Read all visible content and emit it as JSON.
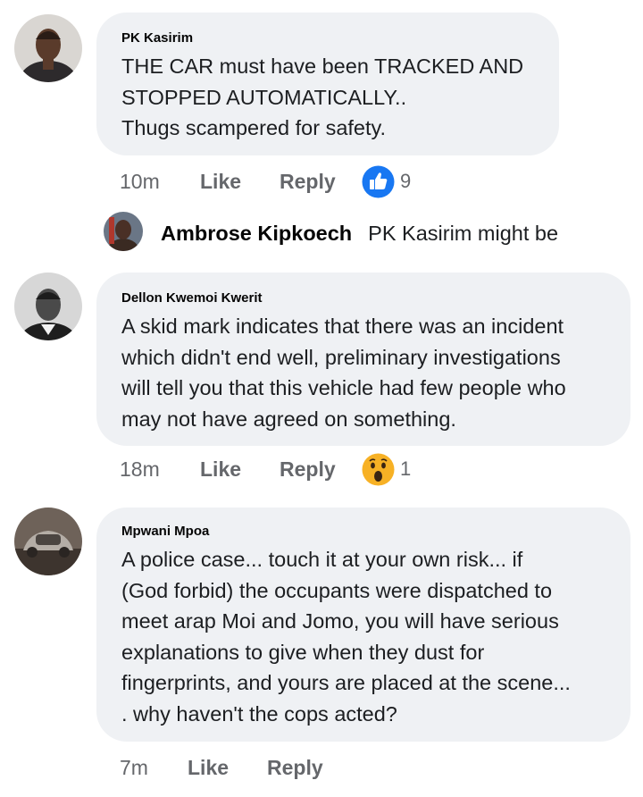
{
  "comments": [
    {
      "author": "PK Kasirim",
      "lines": [
        "THE CAR must have been TRACKED AND",
        "STOPPED AUTOMATICALLY..",
        "Thugs scampered for safety."
      ],
      "time": "10m",
      "like_label": "Like",
      "reply_label": "Reply",
      "reaction": {
        "icon": "thumbs-up-like-icon",
        "color": "#1877f2",
        "count": "9"
      },
      "avatar_icon": "man-avatar",
      "reply_preview": {
        "avatar_icon": "person-avatar",
        "name": "Ambrose Kipkoech",
        "text": "PK Kasirim might be"
      }
    },
    {
      "author": "Dellon Kwemoi Kwerit",
      "lines": [
        "A skid mark indicates that there was an incident",
        "which didn't end well, preliminary investigations",
        "will tell you that this vehicle had few people who",
        "may not have agreed on something."
      ],
      "time": "18m",
      "like_label": "Like",
      "reply_label": "Reply",
      "reaction": {
        "icon": "wow-reaction-icon",
        "color": "#f7b125",
        "count": "1"
      },
      "avatar_icon": "grayscale-man-avatar"
    },
    {
      "author": "Mpwani Mpoa",
      "lines": [
        "A police case... touch it at your own risk... if",
        "(God forbid) the occupants were dispatched to",
        "meet arap Moi and Jomo, you will have serious",
        "explanations to give when they dust for",
        "fingerprints, and yours are placed at the scene...",
        ". why haven't the cops acted?"
      ],
      "time": "7m",
      "like_label": "Like",
      "reply_label": "Reply",
      "avatar_icon": "vintage-car-avatar"
    }
  ]
}
